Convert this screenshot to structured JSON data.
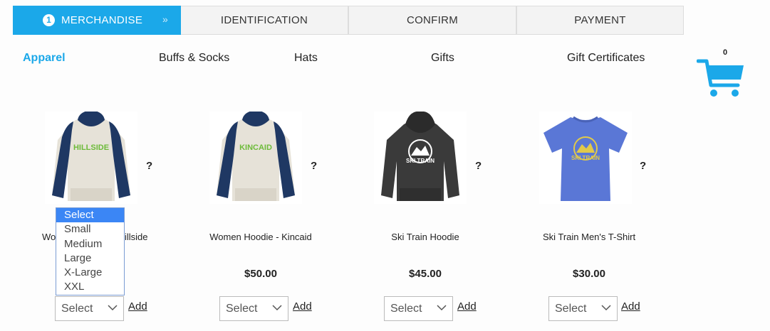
{
  "steps": {
    "active": {
      "number": "1",
      "label": "MERCHANDISE",
      "chevrons": "»"
    },
    "items": [
      {
        "label": "IDENTIFICATION"
      },
      {
        "label": "CONFIRM"
      },
      {
        "label": "PAYMENT"
      }
    ]
  },
  "categories": [
    {
      "label": "Apparel",
      "active": true
    },
    {
      "label": "Buffs & Socks"
    },
    {
      "label": "Hats"
    },
    {
      "label": "Gifts"
    },
    {
      "label": "Gift Certificates"
    }
  ],
  "cart": {
    "count": "0",
    "color": "#1ba8e9",
    "icon": "cart-icon"
  },
  "products": [
    {
      "name": "Women Hoodie - Hillside",
      "visible_name_left": "Wo",
      "visible_name_right": "illside",
      "price": "",
      "logo": "HILLSIDE",
      "garment": "raglan-hoodie",
      "select": "Select",
      "add": "Add"
    },
    {
      "name": "Women Hoodie - Kincaid",
      "price": "$50.00",
      "logo": "KINCAID",
      "garment": "raglan-hoodie",
      "select": "Select",
      "add": "Add"
    },
    {
      "name": "Ski Train Hoodie",
      "price": "$45.00",
      "logo": "SKI TRAIN",
      "garment": "dark-hoodie",
      "select": "Select",
      "add": "Add"
    },
    {
      "name": "Ski Train Men's T-Shirt",
      "price": "$30.00",
      "logo": "SKI TRAIN",
      "garment": "blue-tshirt",
      "select": "Select",
      "add": "Add"
    }
  ],
  "help_mark": "?",
  "size_dropdown": {
    "open_on_product": 0,
    "options": [
      "Select",
      "Small",
      "Medium",
      "Large",
      "X-Large",
      "XXL"
    ],
    "highlighted": "Select"
  },
  "colors": {
    "accent": "#1ba8e9",
    "dropdown_highlight": "#3b86f5"
  }
}
